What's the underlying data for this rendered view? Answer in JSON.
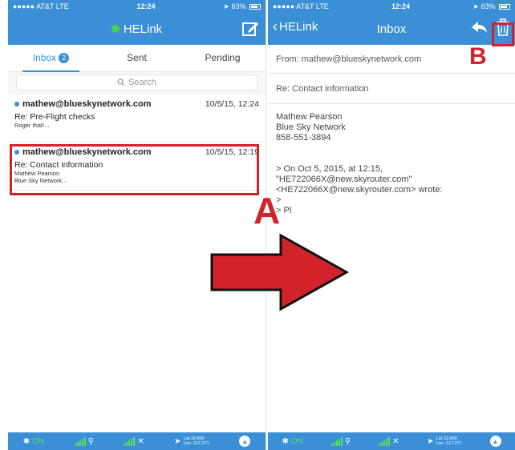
{
  "left": {
    "status": {
      "carrier": "●●●●● AT&T  LTE",
      "time": "12:24",
      "battery": "63%"
    },
    "nav": {
      "title": "HELink"
    },
    "tabs": [
      {
        "label": "Inbox",
        "badge": "2"
      },
      {
        "label": "Sent"
      },
      {
        "label": "Pending"
      }
    ],
    "search": {
      "placeholder": "Search"
    },
    "messages": [
      {
        "sender": "mathew@blueskynetwork.com",
        "date": "10/5/15, 12:24",
        "subject": "Re: Pre-Flight checks",
        "preview": [
          "Roger that!..."
        ]
      },
      {
        "sender": "mathew@blueskynetwork.com",
        "date": "10/5/15, 12:19",
        "subject": "Re: Contact information",
        "preview": [
          "Mathew Pearson",
          "Blue Sky Network..."
        ]
      }
    ],
    "tabbar": {
      "bluetooth": "ON",
      "lat": "Lat 32.869",
      "lon": "Lon -117.271"
    }
  },
  "right": {
    "status": {
      "carrier": "●●●●● AT&T  LTE",
      "time": "12:24",
      "battery": "63%"
    },
    "nav": {
      "back_label": "HELink",
      "title": "Inbox"
    },
    "email": {
      "from_label": "From:",
      "from": "mathew@blueskynetwork.com",
      "subject": "Re: Contact information",
      "signature": [
        "Mathew Pearson",
        "Blue Sky Network",
        "858-551-3894"
      ],
      "quote": [
        "> On Oct 5, 2015, at 12:15,",
        "\"HE722066X@new.skyrouter.com\"",
        "<HE722066X@new.skyrouter.com> wrote:",
        ">",
        "> Pl"
      ]
    },
    "tabbar": {
      "bluetooth": "ON",
      "lat": "Lat 32.869",
      "lon": "Lon -117.271"
    }
  },
  "annotations": {
    "label_a": "A",
    "label_b": "B"
  },
  "colors": {
    "header_blue": "#3a8fd6",
    "highlight_red": "#d2232a",
    "online_green": "#47d14b"
  }
}
